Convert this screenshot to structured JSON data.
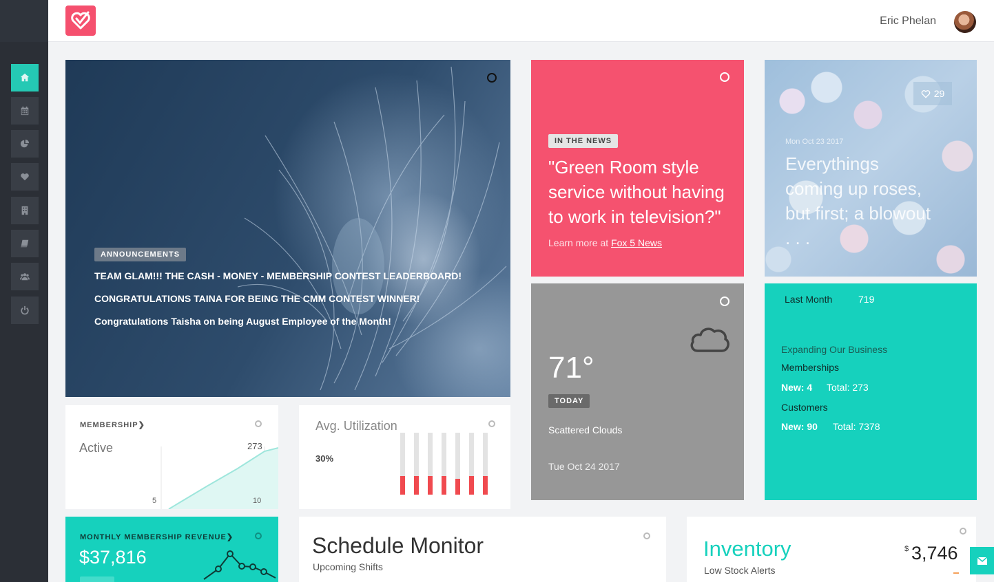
{
  "header": {
    "user_name": "Eric Phelan"
  },
  "sidebar": {
    "items": [
      {
        "name": "home",
        "active": true
      },
      {
        "name": "calendar"
      },
      {
        "name": "reports"
      },
      {
        "name": "favorites"
      },
      {
        "name": "building"
      },
      {
        "name": "book"
      },
      {
        "name": "team"
      },
      {
        "name": "power"
      }
    ]
  },
  "announcements": {
    "tag": "ANNOUNCEMENTS",
    "lines": [
      "TEAM GLAM!!! THE CASH - MONEY - MEMBERSHIP CONTEST LEADERBOARD!",
      "CONGRATULATIONS TAINA FOR BEING THE CMM CONTEST WINNER!",
      "Congratulations Taisha on being August Employee of the Month!"
    ]
  },
  "news": {
    "tag": "IN THE NEWS",
    "quote": "\"Green Room style service without having to work in television?\"",
    "more_prefix": "Learn more at ",
    "more_link": "Fox 5 News"
  },
  "post": {
    "likes": "29",
    "date": "Mon Oct 23 2017",
    "title": "Everythings coming up roses, but first; a blowout . . ."
  },
  "weather": {
    "temp": "71°",
    "tag": "TODAY",
    "condition": "Scattered Clouds",
    "date": "Tue Oct 24 2017"
  },
  "stats": {
    "last_month_label": "Last Month",
    "last_month_value": "719",
    "section_title": "Expanding Our Business",
    "memberships_label": "Memberships",
    "memberships_new": "New: 4",
    "memberships_total": "Total: 273",
    "customers_label": "Customers",
    "customers_new": "New: 90",
    "customers_total": "Total: 7378"
  },
  "membership": {
    "head": "MEMBERSHIP",
    "label": "Active",
    "max_label": "273",
    "x_start": "5",
    "x_end": "10"
  },
  "utilization": {
    "label": "Avg. Utilization",
    "value": "30%",
    "bars": [
      0.3,
      0.3,
      0.3,
      0.3,
      0.25,
      0.3,
      0.3
    ]
  },
  "revenue": {
    "head": "MONTHLY MEMBERSHIP REVENUE",
    "amount": "$37,816"
  },
  "schedule": {
    "title": "Schedule Monitor",
    "subtitle": "Upcoming Shifts"
  },
  "inventory": {
    "title": "Inventory",
    "subtitle": "Low Stock Alerts",
    "currency": "$",
    "value": "3,746"
  },
  "colors": {
    "accent": "#16d1bd",
    "brand": "#f5506e",
    "alert": "#f04a4f",
    "sidebar": "#2b2f36"
  }
}
